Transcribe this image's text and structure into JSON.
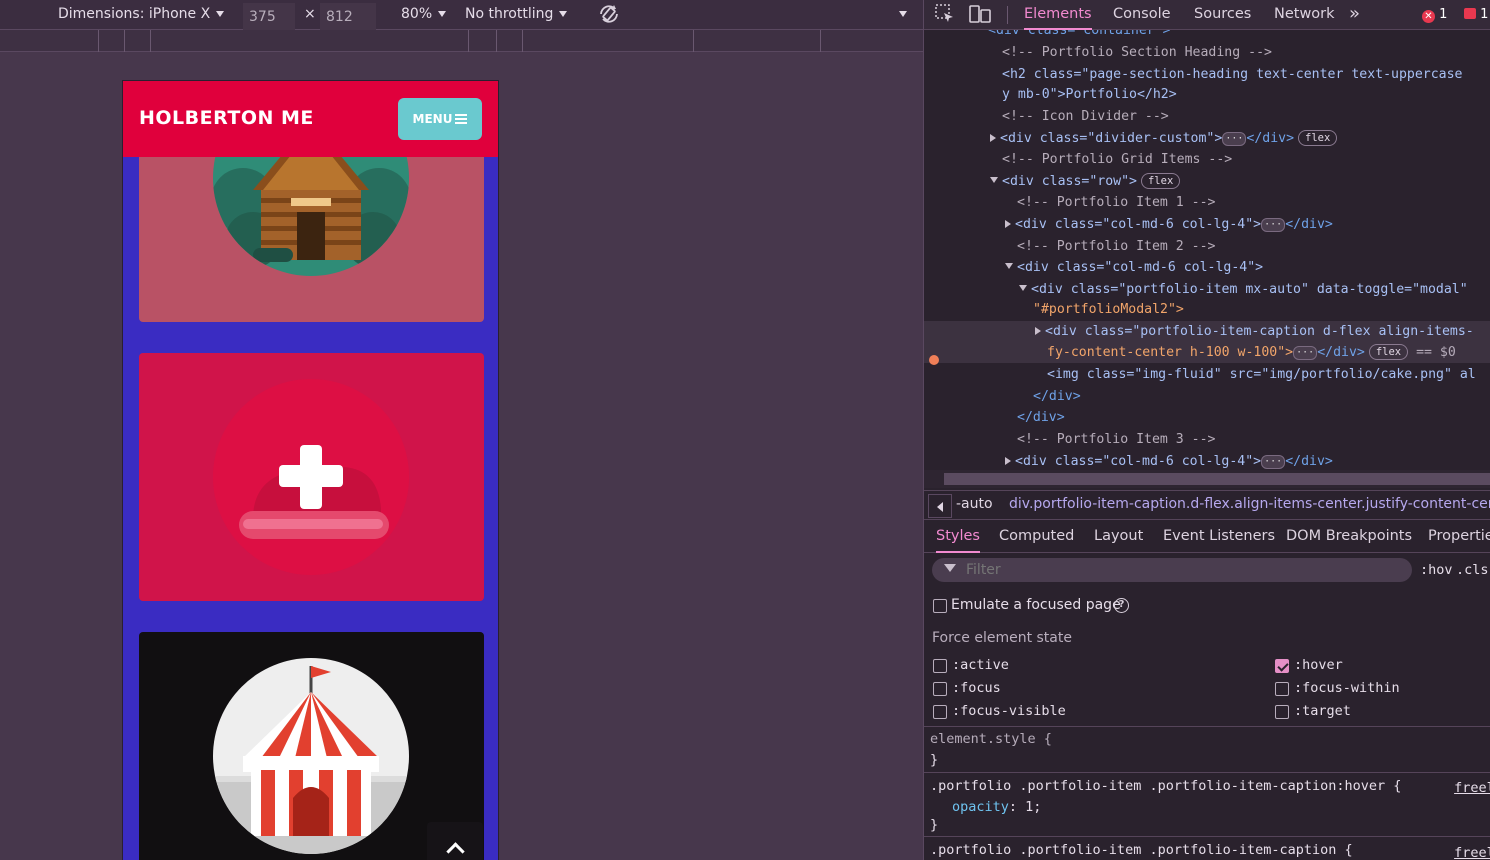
{
  "device_toolbar": {
    "dimensions_label": "Dimensions: iPhone X",
    "width_value": "375",
    "times": "×",
    "height_value": "812",
    "zoom": "80%",
    "throttling": "No throttling"
  },
  "site": {
    "brand": "HOLBERTON ME",
    "menu_label": "MENU"
  },
  "devtools": {
    "tabs": [
      "Elements",
      "Console",
      "Sources",
      "Network"
    ],
    "more": "»",
    "error_count": "1",
    "warning_count": "1",
    "dom_lines": [
      {
        "text": "<div class=\"container\">"
      },
      {
        "text": "<!-- Portfolio Section Heading -->"
      },
      {
        "text": "<h2 class=\"page-section-heading text-center text-uppercase"
      },
      {
        "text": "y mb-0\">Portfolio</h2>"
      },
      {
        "text": "<!-- Icon Divider -->"
      },
      {
        "text": "<div class=\"divider-custom\">"
      },
      {
        "text": "<!-- Portfolio Grid Items -->"
      },
      {
        "text": "<div class=\"row\">"
      },
      {
        "text": "<!-- Portfolio Item 1 -->"
      },
      {
        "text": "<div class=\"col-md-6 col-lg-4\">"
      },
      {
        "text": "<!-- Portfolio Item 2 -->"
      },
      {
        "text": "<div class=\"col-md-6 col-lg-4\">"
      },
      {
        "text": "<div class=\"portfolio-item mx-auto\" data-toggle=\"modal\""
      },
      {
        "text": "\"#portfolioModal2\">"
      },
      {
        "text": "<div class=\"portfolio-item-caption d-flex align-items-"
      },
      {
        "text": "fy-content-center h-100 w-100\">"
      },
      {
        "text": "<img class=\"img-fluid\" src=\"img/portfolio/cake.png\" al"
      },
      {
        "text": "</div>"
      },
      {
        "text": "</div>"
      },
      {
        "text": "<!-- Portfolio Item 3 -->"
      },
      {
        "text": "<div class=\"col-md-6 col-lg-4\">"
      }
    ],
    "pill_flex": "flex",
    "dollar_zero": "== $0",
    "breadcrumb": [
      "-auto",
      "div.portfolio-item-caption.d-flex.align-items-center.justify-content-center"
    ],
    "styles_tabs": [
      "Styles",
      "Computed",
      "Layout",
      "Event Listeners",
      "DOM Breakpoints",
      "Properties"
    ],
    "filter_placeholder": "Filter",
    "hov": ":hov",
    "cls": ".cls",
    "emulate_focus": "Emulate a focused page",
    "force_state_title": "Force element state",
    "states": [
      {
        "name": ":active",
        "checked": false
      },
      {
        "name": ":hover",
        "checked": true
      },
      {
        "name": ":focus",
        "checked": false
      },
      {
        "name": ":focus-within",
        "checked": false
      },
      {
        "name": ":focus-visible",
        "checked": false
      },
      {
        "name": ":target",
        "checked": false
      }
    ],
    "rules": [
      {
        "selector": "element.style {",
        "close": "}"
      },
      {
        "selector": ".portfolio .portfolio-item .portfolio-item-caption:hover {",
        "prop": "opacity",
        "value": "1;",
        "close": "}",
        "source": "freelan"
      },
      {
        "selector": ".portfolio .portfolio-item .portfolio-item-caption {",
        "source": "freelan"
      }
    ]
  }
}
